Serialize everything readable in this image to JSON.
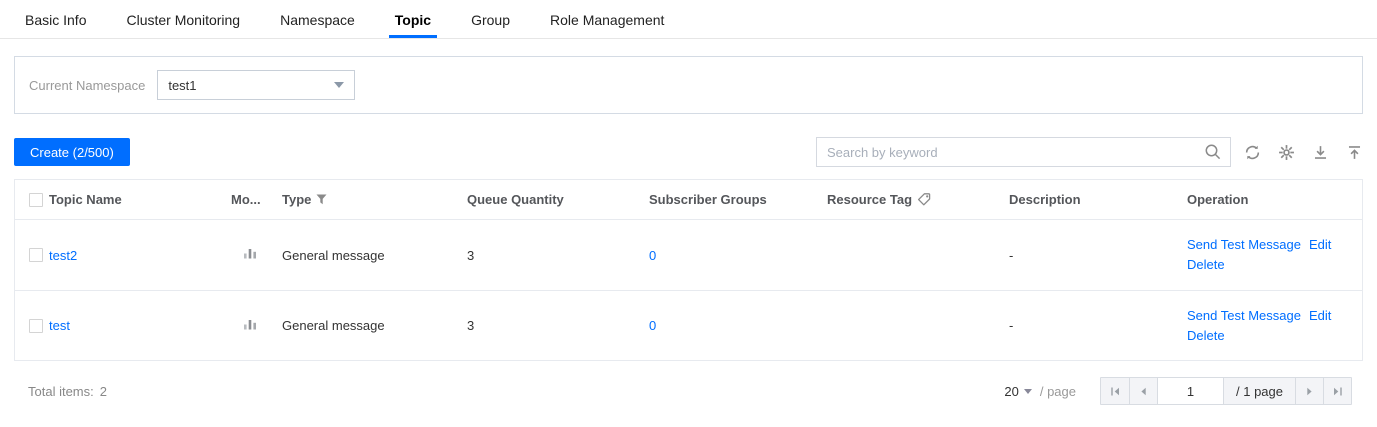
{
  "tabs": {
    "items": [
      {
        "label": "Basic Info",
        "active": false
      },
      {
        "label": "Cluster Monitoring",
        "active": false
      },
      {
        "label": "Namespace",
        "active": false
      },
      {
        "label": "Topic",
        "active": true
      },
      {
        "label": "Group",
        "active": false
      },
      {
        "label": "Role Management",
        "active": false
      }
    ]
  },
  "namespace_bar": {
    "label": "Current Namespace",
    "selected_namespace": "test1"
  },
  "toolbar": {
    "create_label": "Create (2/500)",
    "search_placeholder": "Search by keyword"
  },
  "table": {
    "columns": {
      "topic_name": "Topic Name",
      "monitor": "Mo...",
      "type": "Type",
      "queue_quantity": "Queue Quantity",
      "subscriber_groups": "Subscriber Groups",
      "resource_tag": "Resource Tag",
      "description": "Description",
      "operation": "Operation"
    },
    "rows": [
      {
        "name": "test2",
        "type": "General message",
        "queue_quantity": "3",
        "subscriber_groups": "0",
        "resource_tag": "",
        "description": "-",
        "operations": [
          "Send Test Message",
          "Edit",
          "Delete"
        ]
      },
      {
        "name": "test",
        "type": "General message",
        "queue_quantity": "3",
        "subscriber_groups": "0",
        "resource_tag": "",
        "description": "-",
        "operations": [
          "Send Test Message",
          "Edit",
          "Delete"
        ]
      }
    ]
  },
  "footer": {
    "total_label": "Total items:",
    "total_count": "2",
    "page_size": "20",
    "per_page_label": "/ page",
    "current_page": "1",
    "page_total_label": "/ 1 page"
  },
  "icons": {
    "search": "magnifier",
    "refresh": "circular-arrows",
    "settings": "gear",
    "download": "arrow-down-to-line",
    "back_to_top": "arrow-up-to-line",
    "type_filter": "funnel",
    "resource_tag": "tag",
    "monitor": "bar-chart",
    "pager_first": "first-page",
    "pager_prev": "prev-page",
    "pager_next": "next-page",
    "pager_last": "last-page"
  },
  "colors": {
    "accent": "#006eff",
    "link": "#006eff",
    "text": "#333333",
    "muted": "#888888",
    "border": "#e7eaef"
  }
}
